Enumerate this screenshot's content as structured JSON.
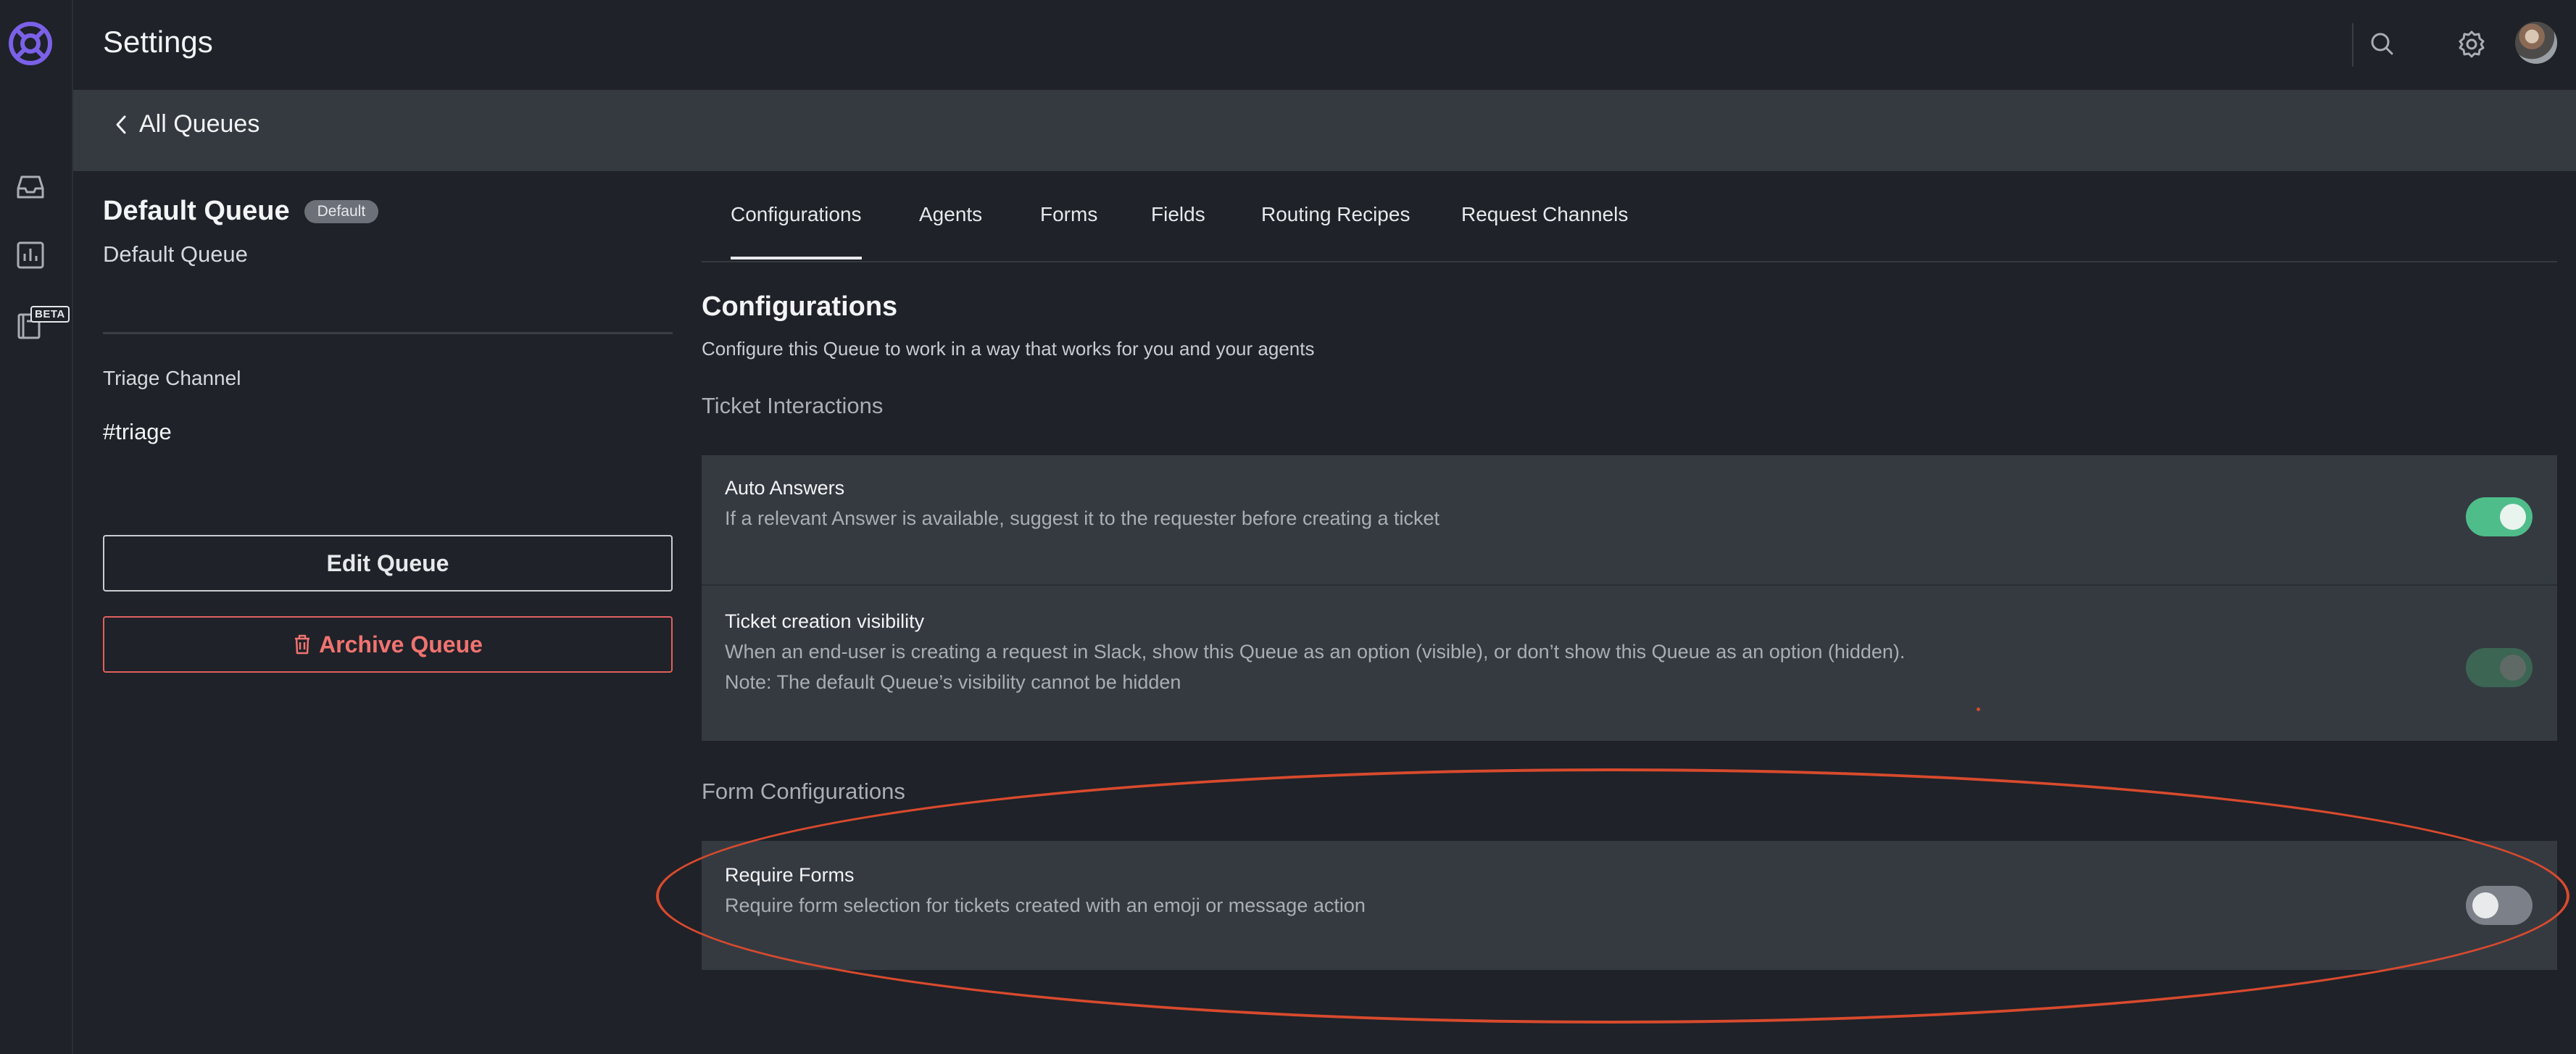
{
  "app": {
    "title": "Settings",
    "beta_badge": "BETA"
  },
  "colors": {
    "accent_logo": "#7b61e8",
    "toggle_on": "#4fbd8a",
    "toggle_off": "#7c8189",
    "danger": "#f07370",
    "annotation": "#d84a2e"
  },
  "rail": {
    "icons": [
      "logo-icon",
      "inbox-icon",
      "analytics-icon",
      "knowledge-base-icon"
    ]
  },
  "topbar": {
    "icons": [
      "search-icon",
      "gear-icon",
      "avatar"
    ]
  },
  "breadcrumb": {
    "back_label": "All Queues"
  },
  "queue": {
    "name": "Default Queue",
    "badge": "Default",
    "subtitle": "Default Queue",
    "triage_label": "Triage Channel",
    "triage_value": "#triage",
    "edit_label": "Edit Queue",
    "archive_label": "Archive Queue"
  },
  "tabs": [
    {
      "label": "Configurations",
      "active": true
    },
    {
      "label": "Agents",
      "active": false
    },
    {
      "label": "Forms",
      "active": false
    },
    {
      "label": "Fields",
      "active": false
    },
    {
      "label": "Routing Recipes",
      "active": false
    },
    {
      "label": "Request Channels",
      "active": false
    }
  ],
  "configurations": {
    "title": "Configurations",
    "description": "Configure this Queue to work in a way that works for you and your agents",
    "ticket_interactions": {
      "label": "Ticket Interactions",
      "rows": [
        {
          "title": "Auto Answers",
          "description": "If a relevant Answer is available, suggest it to the requester before creating a ticket",
          "toggle": "on"
        },
        {
          "title": "Ticket creation visibility",
          "description": "When an end-user is creating a request in Slack, show this Queue as an option (visible), or don’t show this Queue as an option (hidden).",
          "note": "Note: The default Queue’s visibility cannot be hidden",
          "toggle": "on-disabled"
        }
      ]
    },
    "form_configurations": {
      "label": "Form Configurations",
      "rows": [
        {
          "title": "Require Forms",
          "description": "Require form selection for tickets created with an emoji or message action",
          "toggle": "off"
        }
      ]
    }
  }
}
